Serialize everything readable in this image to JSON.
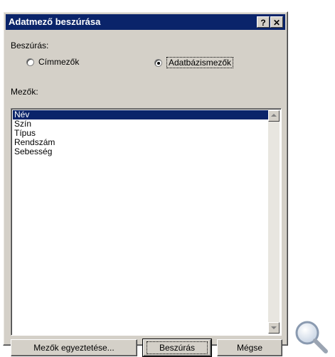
{
  "dialog": {
    "title": "Adatmező beszúrása",
    "help_button": "?",
    "close_button": "✕"
  },
  "insert_group": {
    "label": "Beszúrás:",
    "options": [
      {
        "label": "Címmezők",
        "checked": false
      },
      {
        "label": "Adatbázismezők",
        "checked": true
      }
    ]
  },
  "fields": {
    "label": "Mezők:",
    "items": [
      "Név",
      "Szín",
      "Típus",
      "Rendszám",
      "Sebesség"
    ],
    "selected_index": 0
  },
  "buttons": {
    "match_fields": "Mezők egyeztetése...",
    "insert": "Beszúrás",
    "cancel": "Mégse"
  },
  "icons": {
    "zoom": "magnifier-icon"
  }
}
